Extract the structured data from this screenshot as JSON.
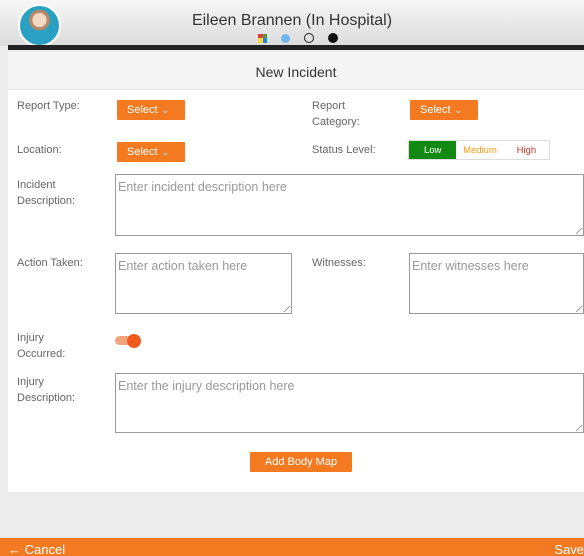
{
  "header": {
    "title": "Eileen Brannen (In Hospital)"
  },
  "form": {
    "title": "New Incident",
    "report_type_label": "Report Type:",
    "report_category_label": "Report Category:",
    "location_label": "Location:",
    "status_level_label": "Status Level:",
    "select_label": "Select",
    "status_options": [
      "Low",
      "Medium",
      "High"
    ],
    "status_selected": "Low",
    "incident_description_label": "Incident Description:",
    "incident_description_placeholder": "Enter incident description here",
    "action_taken_label": "Action Taken:",
    "action_taken_placeholder": "Enter action taken here",
    "witnesses_label": "Witnesses:",
    "witnesses_placeholder": "Enter witnesses here",
    "injury_occurred_label": "Injury Occurred:",
    "injury_occurred_on": true,
    "injury_description_label": "Injury Description:",
    "injury_description_placeholder": "Enter the injury description here",
    "add_body_map_label": "Add Body Map"
  },
  "footer": {
    "cancel_label": "← Cancel",
    "save_label": "Save"
  },
  "colors": {
    "accent": "#f37a21",
    "status_low": "#128a12",
    "status_medium": "#f39c12",
    "status_high": "#c0392b"
  }
}
